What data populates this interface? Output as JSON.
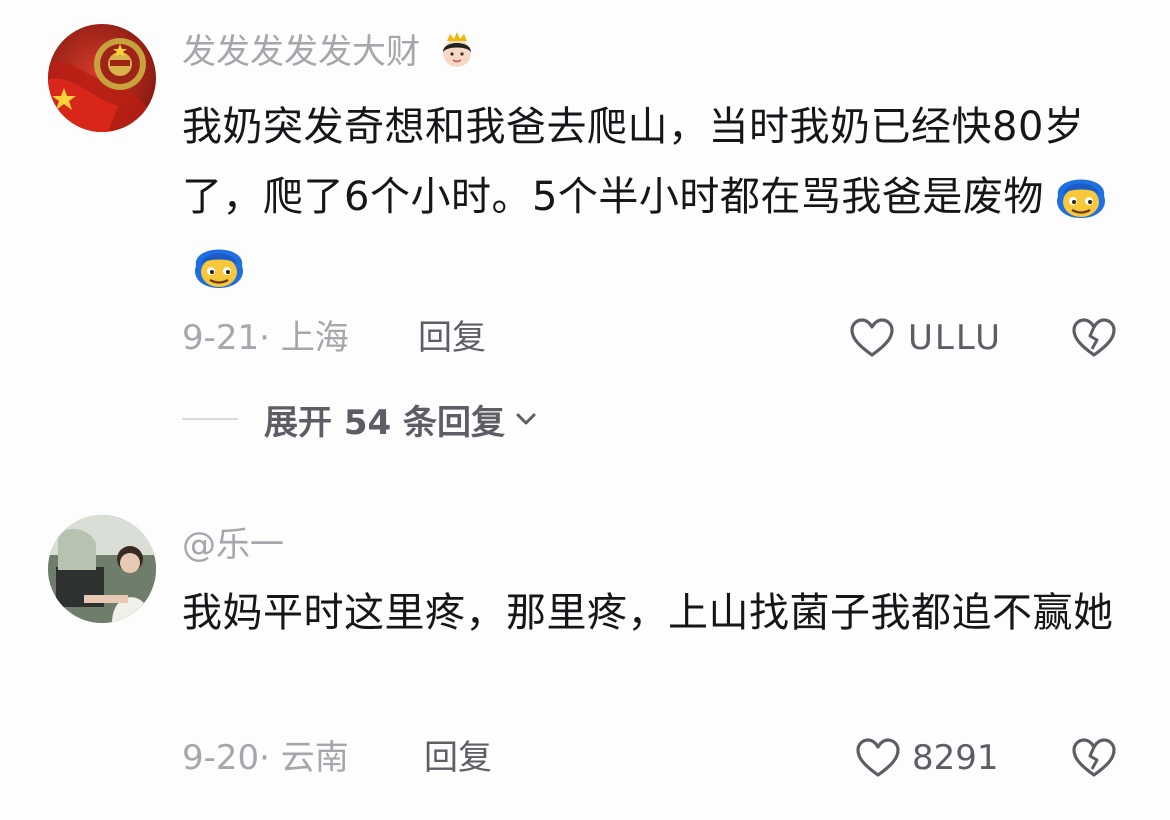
{
  "comments": [
    {
      "username": "发发发发发大财",
      "username_badge_icon": "queen-emoji-icon",
      "text": "我奶突发奇想和我爸去爬山，当时我奶已经快80岁了，爬了6个小时。5个半小时都在骂我爸是废物",
      "trailing_emoji": [
        "blue-hair-grin-emoji",
        "blue-hair-grin-emoji"
      ],
      "date_location": "9-21· 上海",
      "reply_label": "回复",
      "like_count": "ULLU",
      "expand_replies_label": "展开 54 条回复"
    },
    {
      "username": "@乐一",
      "text": "我妈平时这里疼，那里疼，上山找菌子我都追不赢她",
      "date_location": "9-20· 云南",
      "reply_label": "回复",
      "like_count": "8291"
    }
  ],
  "colors": {
    "text_primary": "#16161a",
    "text_secondary": "#a6a6ad",
    "text_action": "#5d5d66",
    "icon_stroke": "#5d5d66"
  }
}
